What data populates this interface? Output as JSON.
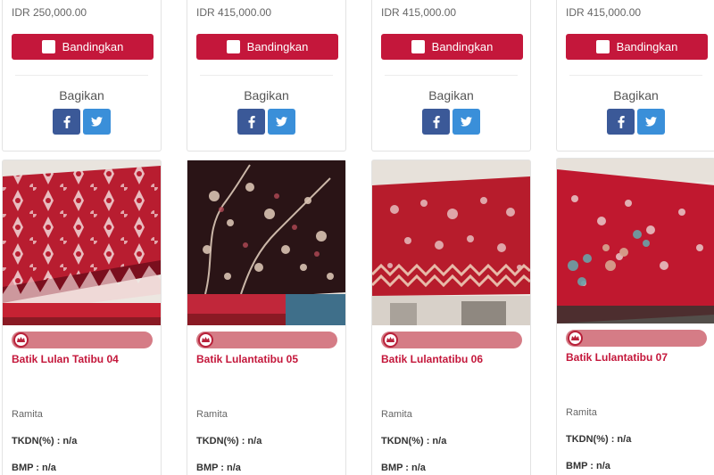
{
  "top_row": [
    {
      "price": "IDR 250,000.00",
      "compare_label": "Bandingkan",
      "share_label": "Bagikan"
    },
    {
      "price": "IDR 415,000.00",
      "compare_label": "Bandingkan",
      "share_label": "Bagikan"
    },
    {
      "price": "IDR 415,000.00",
      "compare_label": "Bandingkan",
      "share_label": "Bagikan"
    },
    {
      "price": "IDR 415,000.00",
      "compare_label": "Bandingkan",
      "share_label": "Bagikan"
    }
  ],
  "products": [
    {
      "title": "Batik Lulan Tatibu 04",
      "seller": "Ramita",
      "tkdn": "TKDN(%) : n/a",
      "bmp": "BMP : n/a",
      "fabric_color": "#b81d30"
    },
    {
      "title": "Batik Lulantatibu 05",
      "seller": "Ramita",
      "tkdn": "TKDN(%) : n/a",
      "bmp": "BMP : n/a",
      "fabric_color": "#2a1416"
    },
    {
      "title": "Batik Lulantatibu 06",
      "seller": "Ramita",
      "tkdn": "TKDN(%) : n/a",
      "bmp": "BMP : n/a",
      "fabric_color": "#b71c2c"
    },
    {
      "title": "Batik Lulantatibu 07",
      "seller": "Ramita",
      "tkdn": "TKDN(%) : n/a",
      "bmp": "BMP : n/a",
      "fabric_color": "#c0182f"
    }
  ],
  "colors": {
    "accent": "#c4173b",
    "rating_bar": "#d57c86",
    "facebook": "#3b5998",
    "twitter": "#3a8fd9"
  },
  "icons": {
    "compare": "checkbox-icon",
    "facebook": "facebook-icon",
    "twitter": "twitter-icon",
    "rating": "crown-badge-icon"
  }
}
